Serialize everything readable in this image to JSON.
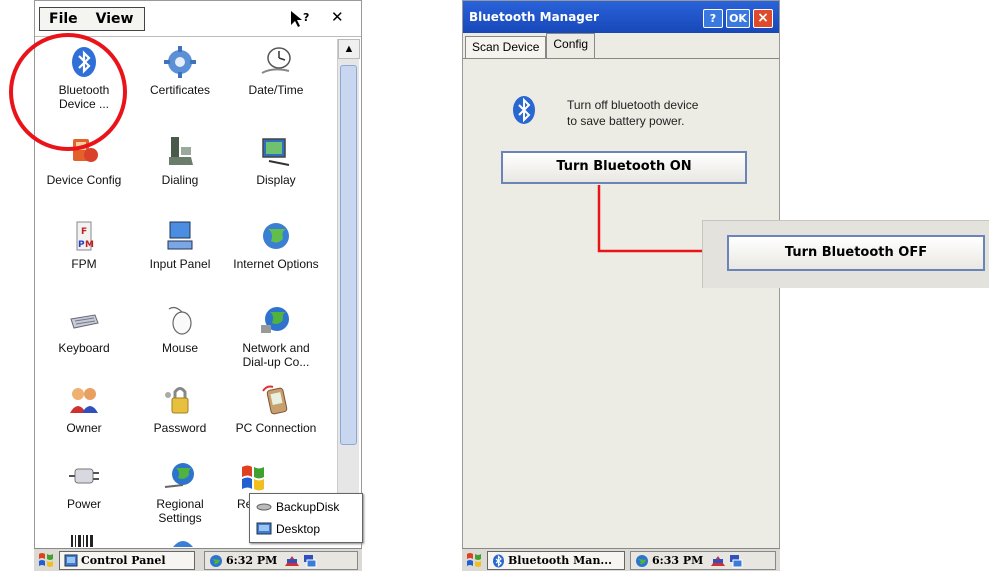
{
  "left": {
    "menu": {
      "file": "File",
      "view": "View"
    },
    "icons": [
      {
        "label": "Bluetooth Device ...",
        "icon": "bluetooth-icon"
      },
      {
        "label": "Certificates",
        "icon": "certificates-icon"
      },
      {
        "label": "Date/Time",
        "icon": "clock-icon"
      },
      {
        "label": "Device Config",
        "icon": "device-config-icon"
      },
      {
        "label": "Dialing",
        "icon": "phone-icon"
      },
      {
        "label": "Display",
        "icon": "display-icon"
      },
      {
        "label": "FPM",
        "icon": "fpm-icon"
      },
      {
        "label": "Input Panel",
        "icon": "keyboard-monitor-icon"
      },
      {
        "label": "Internet Options",
        "icon": "globe-icon"
      },
      {
        "label": "Keyboard",
        "icon": "keyboard-icon"
      },
      {
        "label": "Mouse",
        "icon": "mouse-icon"
      },
      {
        "label": "Network and Dial-up Co...",
        "icon": "network-globe-icon"
      },
      {
        "label": "Owner",
        "icon": "people-icon"
      },
      {
        "label": "Password",
        "icon": "lock-icon"
      },
      {
        "label": "PC Connection",
        "icon": "pda-icon"
      },
      {
        "label": "Power",
        "icon": "power-plug-icon"
      },
      {
        "label": "Regional Settings",
        "icon": "regional-globe-icon"
      },
      {
        "label": "Re Pro",
        "icon": "windows-flag-icon"
      }
    ],
    "popup": {
      "item1": "BackupDisk",
      "item2": "Desktop"
    },
    "taskbar": {
      "task": "Control Panel",
      "time": "6:32 PM"
    }
  },
  "right": {
    "title": "Bluetooth Manager",
    "title_buttons": {
      "help": "?",
      "ok": "OK",
      "close": "×"
    },
    "tabs": [
      "Scan Device",
      "Config"
    ],
    "info_line1": "Turn off bluetooth device",
    "info_line2": "to save battery power.",
    "btn_on": "Turn Bluetooth ON",
    "btn_off": "Turn Bluetooth OFF",
    "taskbar": {
      "task": "Bluetooth Man...",
      "time": "6:33 PM"
    }
  },
  "colors": {
    "annotation_red": "#e8141a",
    "titlebar_blue": "#1f55c8",
    "button_border": "#6b84b7"
  }
}
